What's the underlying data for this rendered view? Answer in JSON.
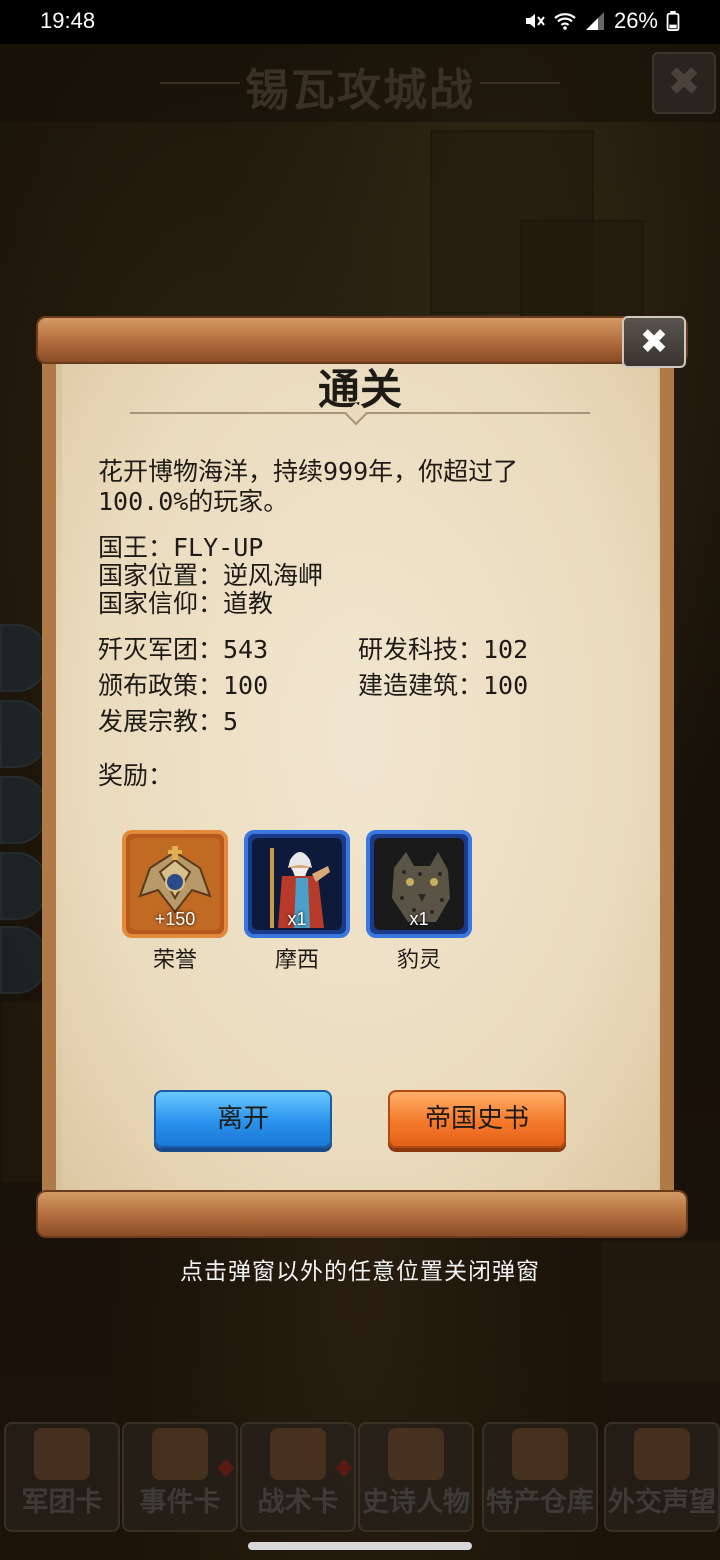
{
  "status_bar": {
    "time": "19:48",
    "battery_percent": "26%",
    "icons": [
      "mute-icon",
      "wifi-icon",
      "signal-icon",
      "battery-icon"
    ]
  },
  "background": {
    "title": "锡瓦攻城战",
    "close_icon": "close-icon",
    "bottom_nav": [
      {
        "label": "军团卡",
        "icon": "helmet-icon"
      },
      {
        "label": "事件卡",
        "icon": "scroll-icon",
        "badge": true
      },
      {
        "label": "战术卡",
        "icon": "shield-icon",
        "badge": true
      },
      {
        "label": "史诗人物",
        "icon": "crown-icon"
      },
      {
        "label": "特产仓库",
        "icon": "chest-icon"
      },
      {
        "label": "外交声望",
        "icon": "letter-icon"
      }
    ]
  },
  "dialog": {
    "title": "通关",
    "summary_line1": "花开博物海洋，持续999年，你超过了",
    "summary_line2": "100.0%的玩家。",
    "info": {
      "king": "国王：FLY-UP",
      "location": "国家位置：逆风海岬",
      "faith": "国家信仰：道教"
    },
    "stats": {
      "destroyed": "歼灭军团：543",
      "research": "研发科技：102",
      "policies": "颁布政策：100",
      "buildings": "建造建筑：100",
      "religions": "发展宗教：5"
    },
    "rewards_label": "奖励：",
    "rewards": [
      {
        "name": "荣誉",
        "qty": "+150",
        "icon": "honor-emblem-icon",
        "frame": "orange"
      },
      {
        "name": "摩西",
        "qty": "x1",
        "icon": "moses-portrait-icon",
        "frame": "blue"
      },
      {
        "name": "豹灵",
        "qty": "x1",
        "icon": "leopard-spirit-icon",
        "frame": "blue"
      }
    ],
    "leave_button": "离开",
    "history_button": "帝国史书",
    "close_icon": "close-icon"
  },
  "hint": "点击弹窗以外的任意位置关闭弹窗",
  "colors": {
    "paper": "#eadbbd",
    "scroll_wood": "#b06c3c",
    "button_blue": "#2a92ec",
    "button_orange": "#f47a2a",
    "frame_orange": "#e08a3a",
    "frame_blue": "#3a78e0"
  }
}
